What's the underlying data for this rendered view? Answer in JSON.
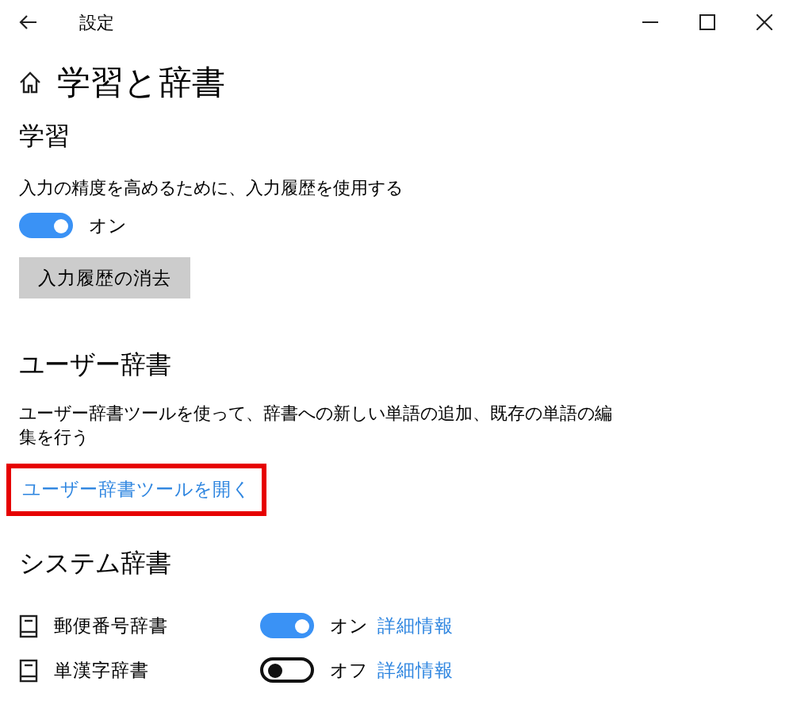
{
  "window": {
    "title": "設定"
  },
  "page": {
    "title": "学習と辞書"
  },
  "learning": {
    "heading": "学習",
    "description": "入力の精度を高めるために、入力履歴を使用する",
    "toggle": {
      "on": true,
      "label": "オン"
    },
    "button": "入力履歴の消去"
  },
  "user_dictionary": {
    "heading": "ユーザー辞書",
    "description": "ユーザー辞書ツールを使って、辞書への新しい単語の追加、既存の単語の編集を行う",
    "link": {
      "label": "ユーザー辞書ツールを開く",
      "highlighted": true
    }
  },
  "system_dictionary": {
    "heading": "システム辞書",
    "items": [
      {
        "name": "郵便番号辞書",
        "on": true,
        "state_label": "オン",
        "link": "詳細情報"
      },
      {
        "name": "単漢字辞書",
        "on": false,
        "state_label": "オフ",
        "link": "詳細情報"
      }
    ]
  }
}
